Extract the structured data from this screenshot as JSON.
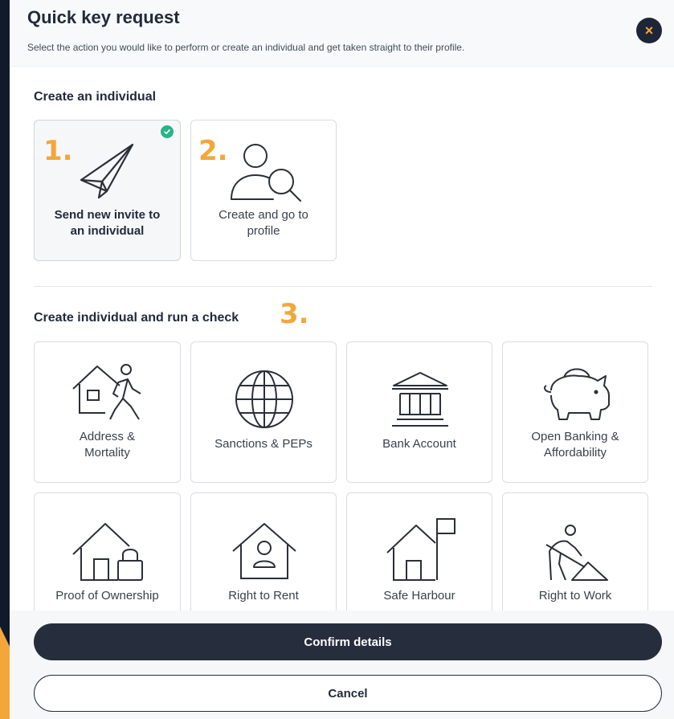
{
  "modal": {
    "title": "Quick key request",
    "subtitle": "Select the action you would like to perform or create an individual and get taken straight to their profile.",
    "close_glyph": "×"
  },
  "create_section": {
    "title": "Create an individual",
    "cards": [
      {
        "step": "1.",
        "label_line1": "Send new invite to",
        "label_line2": "an individual",
        "icon": "paper-plane-icon",
        "selected": true
      },
      {
        "step": "2.",
        "label_line1": "Create and go to",
        "label_line2": "profile",
        "icon": "person-search-icon",
        "selected": false
      }
    ]
  },
  "check_section": {
    "title": "Create individual and run a check",
    "step": "3.",
    "cards": [
      {
        "label_line1": "Address &",
        "label_line2": "Mortality",
        "icon": "house-walking-person-icon"
      },
      {
        "label_line1": "Sanctions & PEPs",
        "label_line2": "",
        "icon": "globe-icon"
      },
      {
        "label_line1": "Bank Account",
        "label_line2": "",
        "icon": "bank-icon"
      },
      {
        "label_line1": "Open Banking &",
        "label_line2": "Affordability",
        "icon": "piggy-bank-icon"
      },
      {
        "label_line1": "Proof of Ownership",
        "label_line2": "",
        "icon": "house-lock-icon"
      },
      {
        "label_line1": "Right to Rent",
        "label_line2": "",
        "icon": "house-person-icon"
      },
      {
        "label_line1": "Safe Harbour",
        "label_line2": "",
        "icon": "house-flag-icon"
      },
      {
        "label_line1": "Right to Work",
        "label_line2": "",
        "icon": "worker-shovel-icon"
      }
    ]
  },
  "footer": {
    "confirm_label": "Confirm details",
    "cancel_label": "Cancel"
  },
  "colors": {
    "accent": "#f3a73a",
    "primary_dark": "#262d3d",
    "success": "#27b48a",
    "backdrop": "#0e1726"
  }
}
